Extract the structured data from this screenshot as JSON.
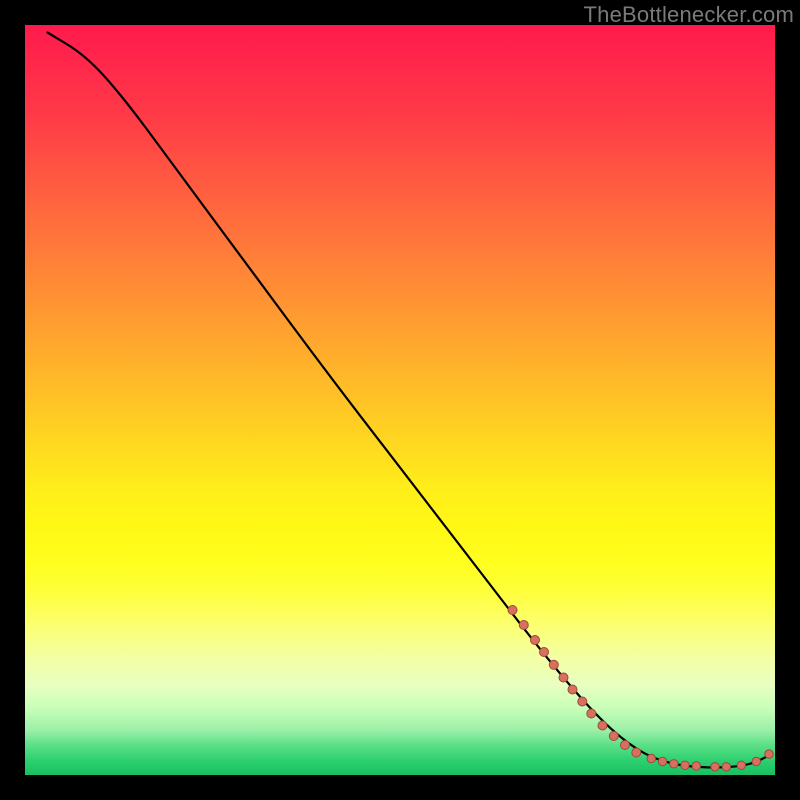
{
  "watermark": "TheBottlenecker.com",
  "chart_data": {
    "type": "line",
    "title": "",
    "xlabel": "",
    "ylabel": "",
    "xlim": [
      0,
      100
    ],
    "ylim": [
      0,
      100
    ],
    "curve": [
      {
        "x": 3,
        "y": 99
      },
      {
        "x": 8,
        "y": 96
      },
      {
        "x": 13,
        "y": 90.5
      },
      {
        "x": 20,
        "y": 81
      },
      {
        "x": 30,
        "y": 67.5
      },
      {
        "x": 40,
        "y": 54
      },
      {
        "x": 50,
        "y": 41
      },
      {
        "x": 60,
        "y": 28
      },
      {
        "x": 70,
        "y": 15
      },
      {
        "x": 77,
        "y": 7
      },
      {
        "x": 82,
        "y": 3
      },
      {
        "x": 86,
        "y": 1.5
      },
      {
        "x": 90,
        "y": 1
      },
      {
        "x": 94,
        "y": 1
      },
      {
        "x": 97,
        "y": 1.5
      },
      {
        "x": 99,
        "y": 2.5
      }
    ],
    "points": [
      {
        "x": 65,
        "y": 22,
        "r": 4.5
      },
      {
        "x": 66.5,
        "y": 20,
        "r": 4.5
      },
      {
        "x": 68,
        "y": 18,
        "r": 4.5
      },
      {
        "x": 69.2,
        "y": 16.4,
        "r": 4.5
      },
      {
        "x": 70.5,
        "y": 14.7,
        "r": 4.5
      },
      {
        "x": 71.8,
        "y": 13,
        "r": 4.5
      },
      {
        "x": 73,
        "y": 11.4,
        "r": 4.5
      },
      {
        "x": 74.3,
        "y": 9.8,
        "r": 4.5
      },
      {
        "x": 75.5,
        "y": 8.2,
        "r": 4.5
      },
      {
        "x": 77,
        "y": 6.6,
        "r": 4.5
      },
      {
        "x": 78.5,
        "y": 5.2,
        "r": 4.5
      },
      {
        "x": 80,
        "y": 4,
        "r": 4.5
      },
      {
        "x": 81.5,
        "y": 3,
        "r": 4.5
      },
      {
        "x": 83.5,
        "y": 2.2,
        "r": 4.2
      },
      {
        "x": 85,
        "y": 1.8,
        "r": 4.2
      },
      {
        "x": 86.5,
        "y": 1.5,
        "r": 4.2
      },
      {
        "x": 88,
        "y": 1.3,
        "r": 4.2
      },
      {
        "x": 89.5,
        "y": 1.2,
        "r": 4.2
      },
      {
        "x": 92,
        "y": 1.1,
        "r": 4.2
      },
      {
        "x": 93.5,
        "y": 1.1,
        "r": 4.2
      },
      {
        "x": 95.5,
        "y": 1.3,
        "r": 4.2
      },
      {
        "x": 97.5,
        "y": 1.8,
        "r": 4.2
      },
      {
        "x": 99.2,
        "y": 2.8,
        "r": 4.2
      }
    ],
    "colors": {
      "curve": "#000000",
      "point_fill": "#d87060",
      "point_stroke": "#a04838"
    }
  }
}
